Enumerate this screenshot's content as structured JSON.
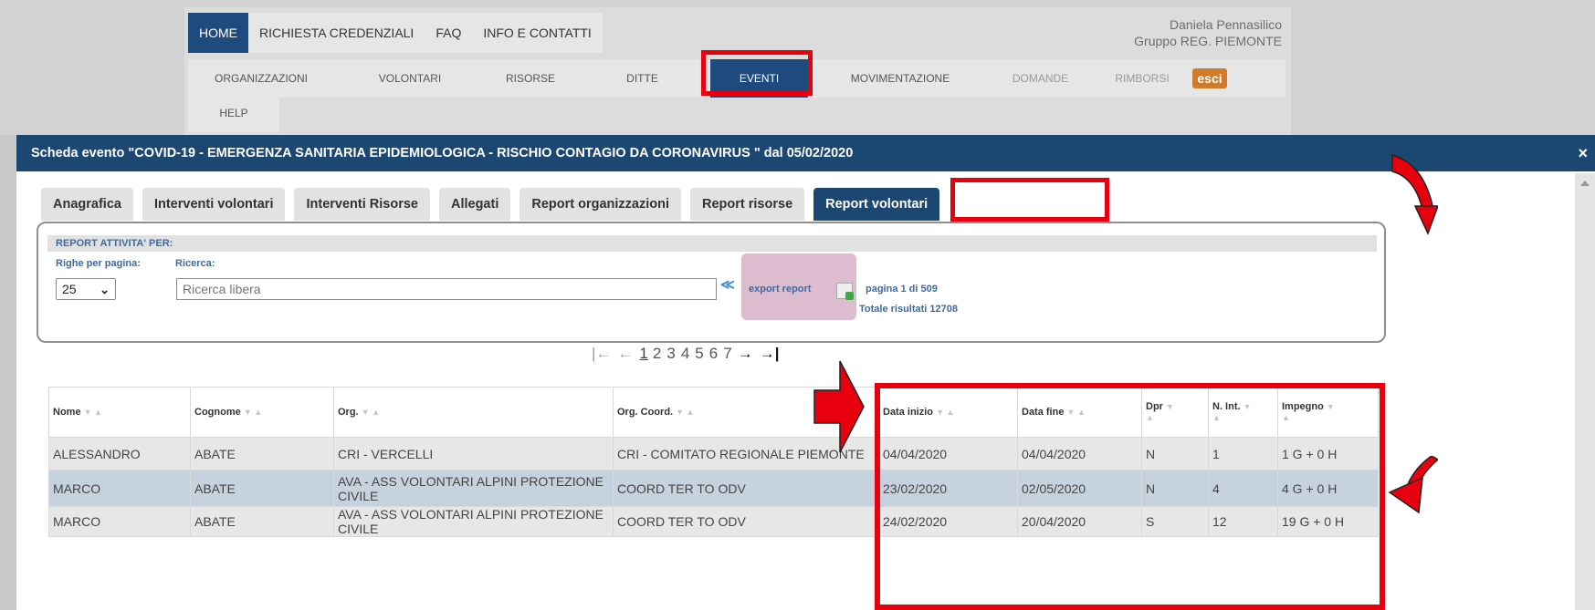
{
  "header": {
    "topnav": [
      "HOME",
      "RICHIESTA CREDENZIALI",
      "FAQ",
      "INFO E CONTATTI"
    ],
    "user_name": "Daniela Pennasilico",
    "user_group": "Gruppo REG. PIEMONTE",
    "menu": [
      "ORGANIZZAZIONI",
      "VOLONTARI",
      "RISORSE",
      "DITTE",
      "EVENTI",
      "MOVIMENTAZIONE",
      "DOMANDE",
      "RIMBORSI"
    ],
    "logout": "esci",
    "help": "HELP"
  },
  "modal": {
    "title": "Scheda evento \"COVID-19 - EMERGENZA SANITARIA EPIDEMIOLOGICA - RISCHIO CONTAGIO DA CORONAVIRUS \" dal 05/02/2020",
    "close": "×",
    "tabs": [
      "Anagrafica",
      "Interventi volontari",
      "Interventi Risorse",
      "Allegati",
      "Report organizzazioni",
      "Report risorse",
      "Report volontari"
    ]
  },
  "filter": {
    "heading": "REPORT ATTIVITA' PER:",
    "rows_label": "Righe per pagina:",
    "rows_value": "25",
    "search_label": "Ricerca:",
    "search_placeholder": "Ricerca libera",
    "export_label": "export report",
    "page_info": "pagina 1 di 509",
    "total": "Totale risultati 12708"
  },
  "pager": {
    "first": "|←",
    "prev": "←",
    "current": "1",
    "pages": [
      "2",
      "3",
      "4",
      "5",
      "6",
      "7"
    ],
    "next": "→",
    "last": "→|"
  },
  "table": {
    "columns": [
      "Nome",
      "Cognome",
      "Org.",
      "Org. Coord.",
      "Data inizio",
      "Data fine",
      "Dpr",
      "N. Int.",
      "Impegno"
    ],
    "rows": [
      [
        "ALESSANDRO",
        "ABATE",
        "CRI - VERCELLI",
        "CRI - COMITATO REGIONALE PIEMONTE",
        "04/04/2020",
        "04/04/2020",
        "N",
        "1",
        "1 G + 0 H"
      ],
      [
        "MARCO",
        "ABATE",
        "AVA - ASS VOLONTARI ALPINI PROTEZIONE CIVILE",
        "COORD TER TO ODV",
        "23/02/2020",
        "02/05/2020",
        "N",
        "4",
        "4 G + 0 H"
      ],
      [
        "MARCO",
        "ABATE",
        "AVA - ASS VOLONTARI ALPINI PROTEZIONE CIVILE",
        "COORD TER TO ODV",
        "24/02/2020",
        "20/04/2020",
        "S",
        "12",
        "19 G + 0 H"
      ]
    ]
  },
  "colors": {
    "navy": "#1c4773",
    "highlight": "#e8000f",
    "row_selected": "#c6d3de",
    "export_bg": "#dcbcce"
  }
}
